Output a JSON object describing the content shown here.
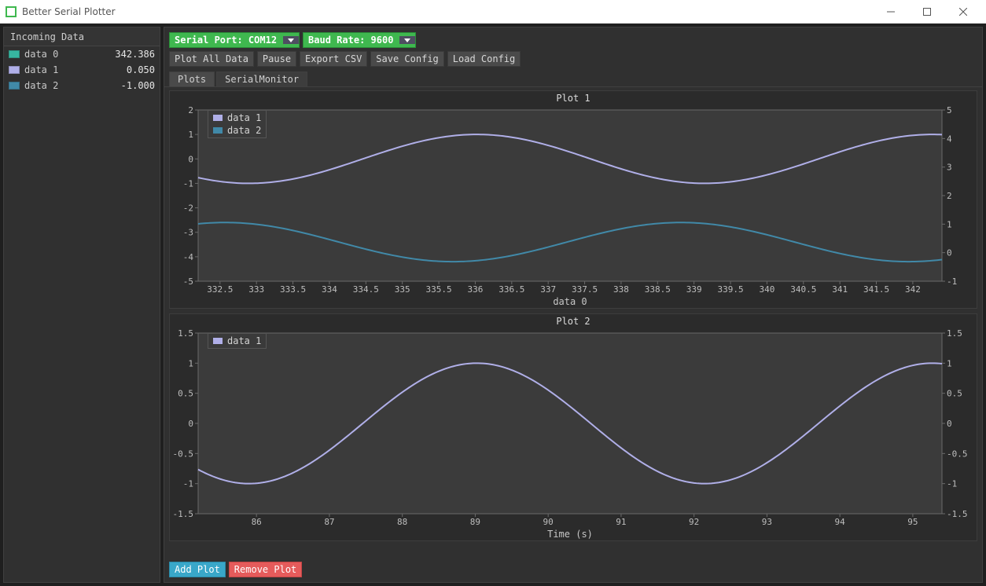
{
  "window": {
    "title": "Better Serial Plotter"
  },
  "sidebar": {
    "header": "Incoming Data",
    "rows": [
      {
        "name": "data 0",
        "value": "342.386",
        "color": "#37b6a0"
      },
      {
        "name": "data 1",
        "value": "0.050",
        "color": "#b0afe8"
      },
      {
        "name": "data 2",
        "value": "-1.000",
        "color": "#4189a8"
      }
    ]
  },
  "controls": {
    "serial_port_label": "Serial Port: COM12",
    "baud_label": "Baud Rate: 9600"
  },
  "buttons": {
    "plot_all": "Plot All Data",
    "pause": "Pause",
    "export": "Export CSV",
    "save_cfg": "Save Config",
    "load_cfg": "Load Config"
  },
  "tabs": {
    "plots": "Plots",
    "serial_monitor": "SerialMonitor"
  },
  "footer": {
    "add_plot": "Add Plot",
    "remove_plot": "Remove Plot"
  },
  "chart_data": [
    {
      "type": "line",
      "title": "Plot 1",
      "xlabel": "data 0",
      "x_range": [
        332.2,
        342.4
      ],
      "x_ticks": [
        332.5,
        333,
        333.5,
        334,
        334.5,
        335,
        335.5,
        336,
        336.5,
        337,
        337.5,
        338,
        338.5,
        339,
        339.5,
        340,
        340.5,
        341,
        341.5,
        342
      ],
      "y_left_range": [
        -5,
        2
      ],
      "y_left_ticks": [
        -5,
        -4,
        -3,
        -2,
        -1,
        0,
        1,
        2
      ],
      "y_right_range": [
        -1,
        5
      ],
      "y_right_ticks": [
        -1,
        0,
        1,
        2,
        3,
        4,
        5
      ],
      "series": [
        {
          "name": "data 1",
          "color": "#b0afe8",
          "axis": "left",
          "amplitude": 1.0,
          "offset": 0.0,
          "period": 6.25,
          "phase_at_xmin": -2.27
        },
        {
          "name": "data 2",
          "color": "#4189a8",
          "axis": "left",
          "amplitude": 0.8,
          "offset": -3.4,
          "period": 6.25,
          "phase_at_xmin": 1.2
        }
      ]
    },
    {
      "type": "line",
      "title": "Plot 2",
      "xlabel": "Time (s)",
      "x_range": [
        85.2,
        95.4
      ],
      "x_ticks": [
        86,
        87,
        88,
        89,
        90,
        91,
        92,
        93,
        94,
        95
      ],
      "y_left_range": [
        -1.5,
        1.5
      ],
      "y_left_ticks": [
        -1.5,
        -1,
        -0.5,
        0,
        0.5,
        1,
        1.5
      ],
      "y_right_range": [
        -1.5,
        1.5
      ],
      "y_right_ticks": [
        -1.5,
        -1,
        -0.5,
        0,
        0.5,
        1,
        1.5
      ],
      "series": [
        {
          "name": "data 1",
          "color": "#b0afe8",
          "axis": "left",
          "amplitude": 1.0,
          "offset": 0.0,
          "period": 6.25,
          "phase_at_xmin": -2.27
        }
      ]
    }
  ]
}
